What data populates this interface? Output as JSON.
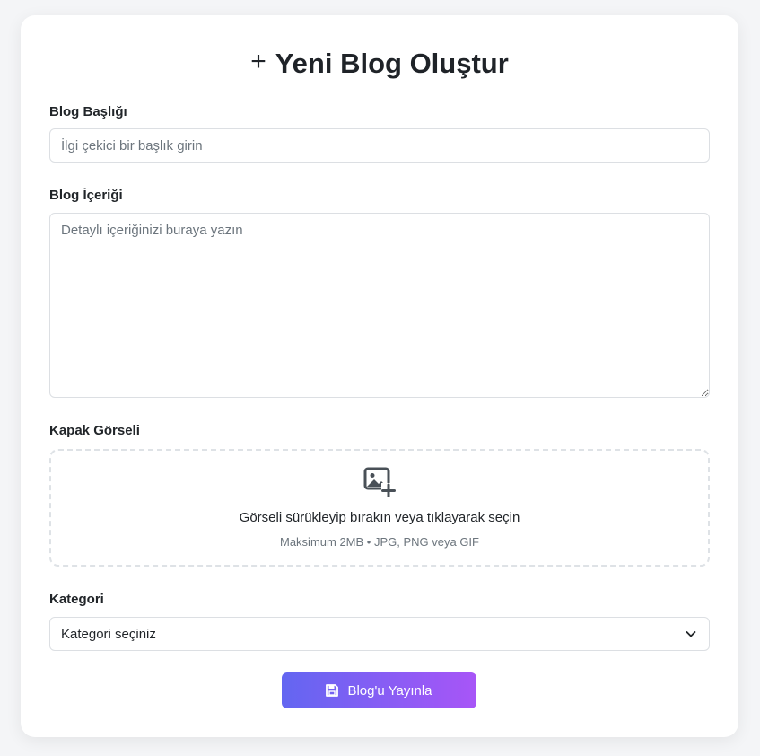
{
  "form": {
    "title": "Yeni Blog Oluştur",
    "title_icon": "plus-icon",
    "blog_title": {
      "label": "Blog Başlığı",
      "placeholder": "İlgi çekici bir başlık girin",
      "value": ""
    },
    "blog_content": {
      "label": "Blog İçeriği",
      "placeholder": "Detaylı içeriğinizi buraya yazın",
      "value": ""
    },
    "cover_image": {
      "label": "Kapak Görseli",
      "icon": "image-add-icon",
      "main_text": "Görseli sürükleyip bırakın veya tıklayarak seçin",
      "sub_text": "Maksimum 2MB • JPG, PNG veya GIF"
    },
    "category": {
      "label": "Kategori",
      "selected": "Kategori seçiniz"
    },
    "submit": {
      "label": "Blog'u Yayınla",
      "icon": "save-icon",
      "gradient_start": "#6366f1",
      "gradient_end": "#a855f7"
    }
  }
}
